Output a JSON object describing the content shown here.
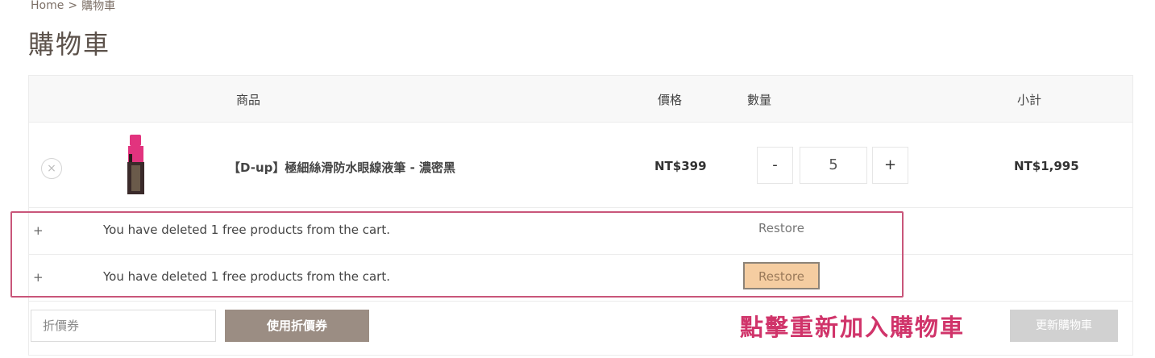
{
  "breadcrumb": {
    "home": "Home",
    "separator": ">",
    "current": "購物車"
  },
  "page_title": "購物車",
  "table": {
    "headers": {
      "product": "商品",
      "price": "價格",
      "quantity": "數量",
      "subtotal": "小計"
    }
  },
  "item": {
    "remove_icon": "×",
    "name": "【D-up】極細絲滑防水眼線液筆 - 濃密黑",
    "price": "NT$399",
    "quantity": "5",
    "decrease_label": "-",
    "increase_label": "+",
    "subtotal": "NT$1,995",
    "thumb_color": "#e2337e"
  },
  "deleted_notices": [
    {
      "plus": "+",
      "message": "You have deleted 1 free products from the cart.",
      "restore_label": "Restore"
    },
    {
      "plus": "+",
      "message": "You have deleted 1 free products from the cart.",
      "restore_label": "Restore"
    }
  ],
  "coupon": {
    "placeholder": "折價券",
    "apply_label": "使用折價券"
  },
  "annotation": "點擊重新加入購物車",
  "update_label": "更新購物車",
  "colors": {
    "accent": "#9b8d83",
    "annotation": "#d0346a",
    "highlight_restore": "#f5cda1"
  }
}
